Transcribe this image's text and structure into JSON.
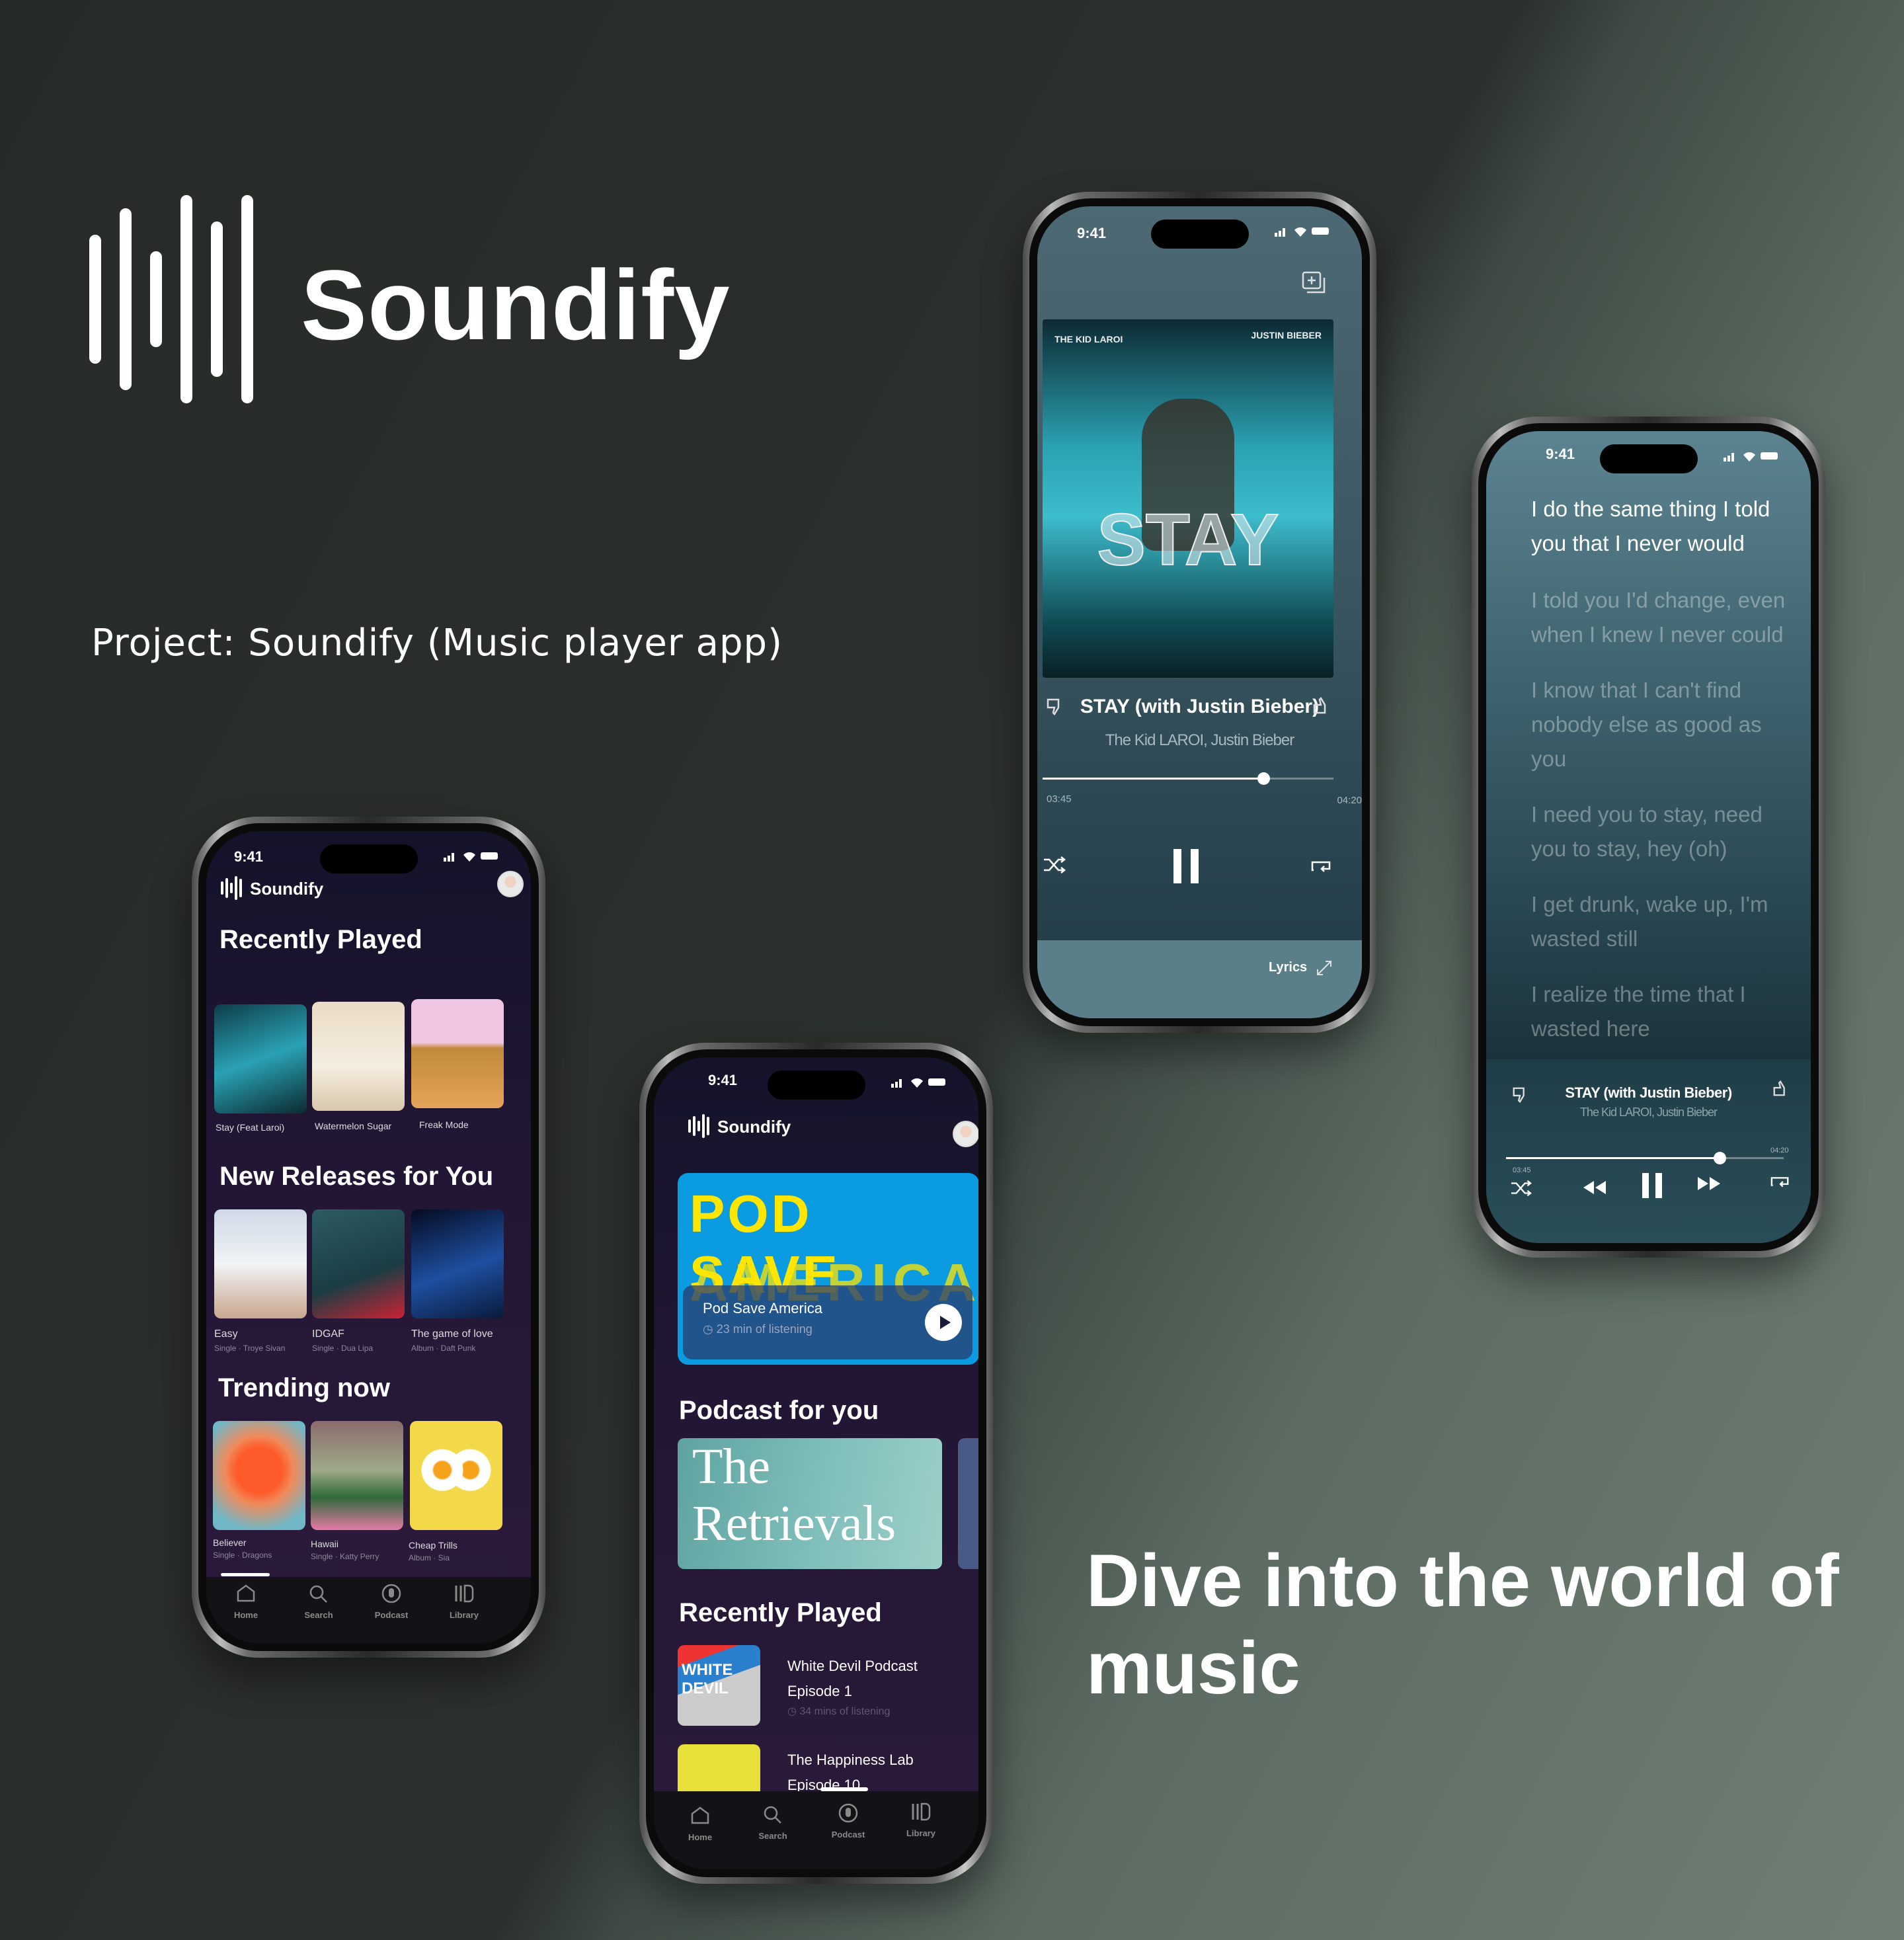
{
  "brand": {
    "name": "Soundify"
  },
  "project_label": "Project: Soundify (Music player app)",
  "tagline": "Dive into the world of music",
  "home_screen": {
    "status_time": "9:41",
    "app_name": "Soundify",
    "sections": [
      {
        "title": "Recently Played",
        "items": [
          {
            "title": "Stay (Feat Laroi)"
          },
          {
            "title": "Watermelon Sugar"
          },
          {
            "title": "Freak Mode"
          }
        ]
      },
      {
        "title": "New Releases for You",
        "items": [
          {
            "title": "Easy",
            "subtitle": "Single · Troye Sivan"
          },
          {
            "title": "IDGAF",
            "subtitle": "Single · Dua Lipa"
          },
          {
            "title": "The game of love",
            "subtitle": "Album · Daft Punk"
          }
        ]
      },
      {
        "title": "Trending now",
        "items": [
          {
            "title": "Believer",
            "subtitle": "Single · Dragons"
          },
          {
            "title": "Hawaii",
            "subtitle": "Single · Katty Perry"
          },
          {
            "title": "Cheap Trills",
            "subtitle": "Album · Sia"
          }
        ]
      }
    ],
    "nav": [
      {
        "label": "Home",
        "icon": "home-icon"
      },
      {
        "label": "Search",
        "icon": "search-icon"
      },
      {
        "label": "Podcast",
        "icon": "podcast-icon"
      },
      {
        "label": "Library",
        "icon": "library-icon"
      }
    ],
    "active_nav": "Home"
  },
  "podcast_screen": {
    "status_time": "9:41",
    "app_name": "Soundify",
    "featured": {
      "art_line1": "POD SAVE",
      "art_line2": "AMERICA",
      "title": "Pod Save America",
      "duration": "23 min of listening"
    },
    "section_for_you": "Podcast for you",
    "for_you": [
      {
        "art_line1": "The",
        "art_line2": "Retrievals"
      }
    ],
    "section_recent": "Recently Played",
    "recent": [
      {
        "title": "White Devil Podcast",
        "episode": "Episode 1",
        "duration": "34 mins of listening",
        "art_text": "WHITE DEVIL"
      },
      {
        "title": "The Happiness Lab",
        "episode": "Episode 10"
      }
    ],
    "nav": [
      {
        "label": "Home"
      },
      {
        "label": "Search"
      },
      {
        "label": "Podcast"
      },
      {
        "label": "Library"
      }
    ],
    "active_nav": "Podcast"
  },
  "player_screen": {
    "status_time": "9:41",
    "art": {
      "artist_left": "THE KID LAROI",
      "artist_right": "JUSTIN BIEBER",
      "title_text": "STAY"
    },
    "track_title": "STAY (with Justin Bieber)",
    "artists": "The Kid LAROI, Justin Bieber",
    "elapsed": "03:45",
    "total": "04:20",
    "progress": 0.76,
    "lyrics_label": "Lyrics"
  },
  "lyrics_screen": {
    "status_time": "9:41",
    "stanzas": [
      {
        "active": true,
        "lines": [
          "I do the same thing I told",
          "you that I never would"
        ]
      },
      {
        "active": false,
        "lines": [
          "I told you I'd change, even",
          "when I knew I never could"
        ]
      },
      {
        "active": false,
        "lines": [
          "I know that I can't find",
          "nobody else as good as",
          "you"
        ]
      },
      {
        "active": false,
        "lines": [
          "I need you to stay, need",
          "you to stay, hey (oh)"
        ]
      },
      {
        "active": false,
        "lines": [
          "I get drunk, wake up, I'm",
          "wasted still"
        ]
      },
      {
        "active": false,
        "lines": [
          "I realize the time that I",
          "wasted here"
        ]
      }
    ],
    "track_title": "STAY (with Justin Bieber)",
    "artists": "The Kid LAROI, Justin Bieber",
    "elapsed": "03:45",
    "total": "04:20",
    "progress": 0.77
  },
  "colors": {
    "background": "#2b302c",
    "background_light": "#6f7f74",
    "home_bg": "#241733",
    "podcast_banner": "#0a9be0",
    "podcast_banner_text": "#ffe600",
    "player_bg": "#3e5a64"
  }
}
